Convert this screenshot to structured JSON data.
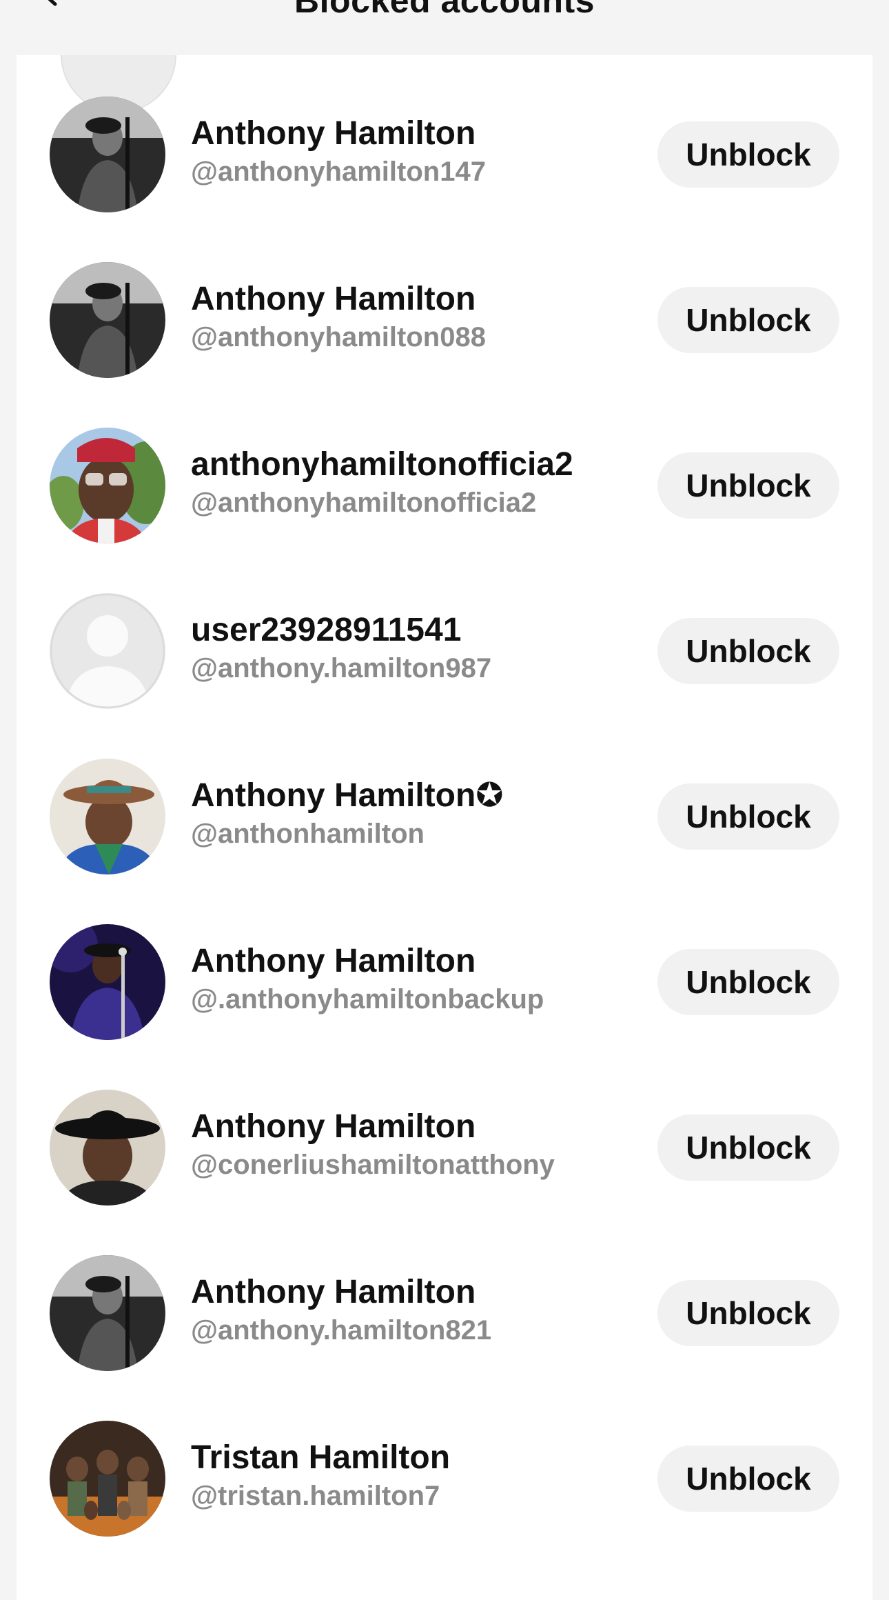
{
  "header": {
    "title": "Blocked accounts",
    "back_icon": "chevron-left-icon"
  },
  "accounts": [
    {
      "name": "Anthony Hamilton",
      "handle": "@anthonyhamilton147",
      "button": "Unblock",
      "avatar": "bw-singer-photo"
    },
    {
      "name": "Anthony Hamilton",
      "handle": "@anthonyhamilton088",
      "button": "Unblock",
      "avatar": "bw-singer-photo"
    },
    {
      "name": "anthonyhamiltonofficia2",
      "handle": "@anthonyhamiltonofficia2",
      "button": "Unblock",
      "avatar": "red-hat-sunglasses-photo"
    },
    {
      "name": "user23928911541",
      "handle": "@anthony.hamilton987",
      "button": "Unblock",
      "avatar": "default-avatar"
    },
    {
      "name": "Anthony Hamilton✪",
      "handle": "@anthonhamilton",
      "button": "Unblock",
      "avatar": "hat-blue-jacket-photo"
    },
    {
      "name": "Anthony Hamilton",
      "handle": "@.anthonyhamiltonbackup",
      "button": "Unblock",
      "avatar": "stage-purple-photo"
    },
    {
      "name": "Anthony Hamilton",
      "handle": "@conerliushamiltonatthony",
      "button": "Unblock",
      "avatar": "black-hat-selfie-photo"
    },
    {
      "name": "Anthony Hamilton",
      "handle": "@anthony.hamilton821",
      "button": "Unblock",
      "avatar": "bw-singer-photo"
    },
    {
      "name": "Tristan Hamilton",
      "handle": "@tristan.hamilton7",
      "button": "Unblock",
      "avatar": "group-photo"
    }
  ]
}
